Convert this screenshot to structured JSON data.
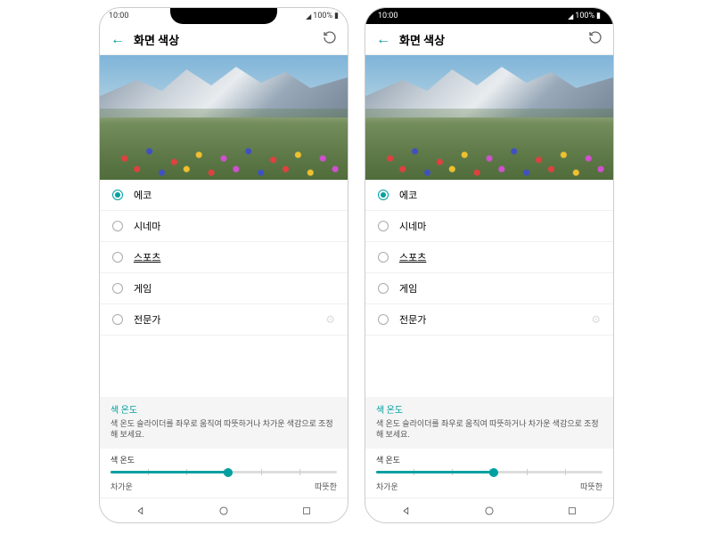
{
  "status": {
    "time": "10:00",
    "signal_text": "100%"
  },
  "header": {
    "title": "화면 색상"
  },
  "options": [
    {
      "label": "에코",
      "selected": true
    },
    {
      "label": "시네마",
      "selected": false
    },
    {
      "label": "스포츠",
      "selected": false,
      "underline": true
    },
    {
      "label": "게임",
      "selected": false
    },
    {
      "label": "전문가",
      "selected": false,
      "gear": true
    }
  ],
  "temp": {
    "section_title": "색 온도",
    "description": "색 온도 슬라이더를 좌우로 움직여 따뜻하거나 차가운 색감으로 조정해 보세요.",
    "slider_label": "색 온도",
    "cold_label": "차가운",
    "warm_label": "따뜻한",
    "slider_value_percent": 52
  }
}
